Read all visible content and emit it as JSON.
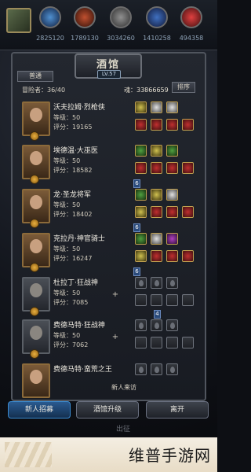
{
  "top_resources": [
    {
      "icon": "blue-gem-icon",
      "value": "2825120"
    },
    {
      "icon": "red-ore-icon",
      "value": "1789130"
    },
    {
      "icon": "gray-ore-icon",
      "value": "3034260"
    },
    {
      "icon": "blue-ore-icon",
      "value": "1410258"
    },
    {
      "icon": "red-flame-icon",
      "value": "494358"
    }
  ],
  "panel": {
    "title": "酒馆",
    "level": "LV.57",
    "tab_label": "普通",
    "adventurers_label": "冒险者：36/40",
    "soul_label": "魂：",
    "soul_value": "33866659",
    "sort_button": "排序"
  },
  "heroes": [
    {
      "name": "沃夫拉姆·烈枪侠",
      "level": "等级：50",
      "score": "评分：19165"
    },
    {
      "name": "埃德温·大巫医",
      "level": "等级：50",
      "score": "评分：18582"
    },
    {
      "name": "龙·圣龙将军",
      "level": "等级：50",
      "score": "评分：18402"
    },
    {
      "name": "克拉丹·神官骑士",
      "level": "等级：50",
      "score": "评分：16247"
    },
    {
      "name": "杜拉丁·狂战神",
      "level": "等级：50",
      "score": "评分：7085"
    },
    {
      "name": "费德马特·狂战神",
      "level": "等级：50",
      "score": "评分：7062"
    },
    {
      "name": "费德马特·蛮荒之王",
      "level": "",
      "score": ""
    }
  ],
  "badges": {
    "b1": "6",
    "b2": "6",
    "b3": "6",
    "b4": "4"
  },
  "bottom": {
    "visitor_label": "新人来访",
    "recruit_button": "新人招募",
    "upgrade_button": "酒馆升级",
    "leave_button": "离开",
    "exit_text": "出征"
  },
  "watermark": "维普手游网"
}
